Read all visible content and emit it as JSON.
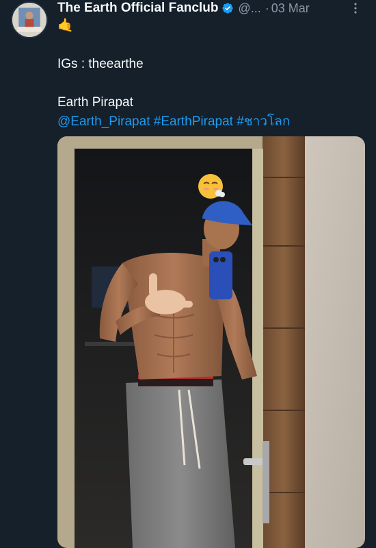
{
  "author": {
    "display_name": "The Earth Official Fanclub",
    "handle": "@...",
    "separator": "·",
    "timestamp": "03 Mar",
    "verified": true,
    "avatar_icon": "profile-avatar"
  },
  "tweet": {
    "line1": "🤙",
    "line2": "IGs : theearthe",
    "line3": "Earth Pirapat",
    "mention": "@Earth_Pirapat",
    "hashtag1": "#EarthPirapat",
    "hashtag2": "#ชาวโลก"
  },
  "media": {
    "type": "photo",
    "overlay_emoji": "😮‍💨"
  },
  "colors": {
    "background": "#15202b",
    "text": "#f7f9f9",
    "muted": "#8b98a5",
    "link": "#1d9bf0",
    "verified": "#1d9bf0"
  },
  "icons": {
    "verified": "verified-badge-icon",
    "more": "more-options-icon"
  }
}
